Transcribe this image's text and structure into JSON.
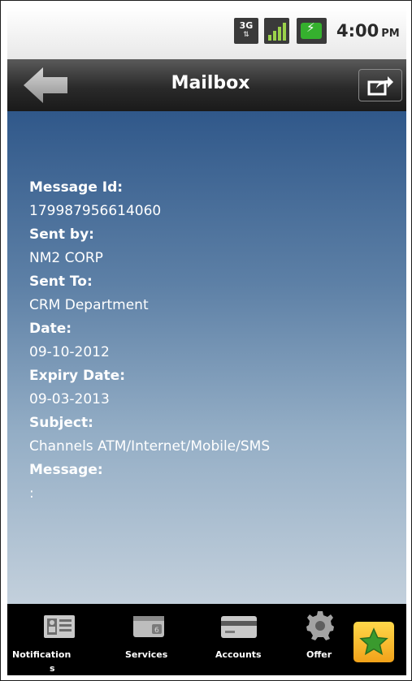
{
  "status_bar": {
    "network_label": "3G",
    "network_arrows": "⇅",
    "battery_bolt": "⚡",
    "time": "4:00",
    "ampm": "PM"
  },
  "header": {
    "title": "Mailbox",
    "back_icon": "back-arrow-icon",
    "share_icon": "share-icon"
  },
  "message": {
    "message_id_label": "Message Id:",
    "message_id": "179987956614060",
    "sent_by_label": "Sent by:",
    "sent_by": "NM2 CORP",
    "sent_to_label": "Sent To:",
    "sent_to": "CRM Department",
    "date_label": "Date:",
    "date": "09-10-2012",
    "expiry_date_label": "Expiry Date:",
    "expiry_date": "09-03-2013",
    "subject_label": "Subject:",
    "subject": "Channels  ATM/Internet/Mobile/SMS",
    "message_label": "Message:",
    "message_body": ":"
  },
  "bottom_nav": {
    "items": [
      {
        "label_line1": "Notification",
        "label_line2": "s",
        "icon": "contact-card-icon"
      },
      {
        "label_line1": "Services",
        "icon": "wallet-icon"
      },
      {
        "label_line1": "Accounts",
        "icon": "credit-card-icon"
      },
      {
        "label_line1": "Offer",
        "icon": "gear-icon"
      }
    ],
    "favorite_icon": "star-icon"
  },
  "colors": {
    "accent_green": "#35b02e",
    "content_top": "#30588a",
    "content_bottom": "#c3d0dc",
    "favorite_orange": "#f2a21a",
    "star_green": "#3a9a2e"
  }
}
